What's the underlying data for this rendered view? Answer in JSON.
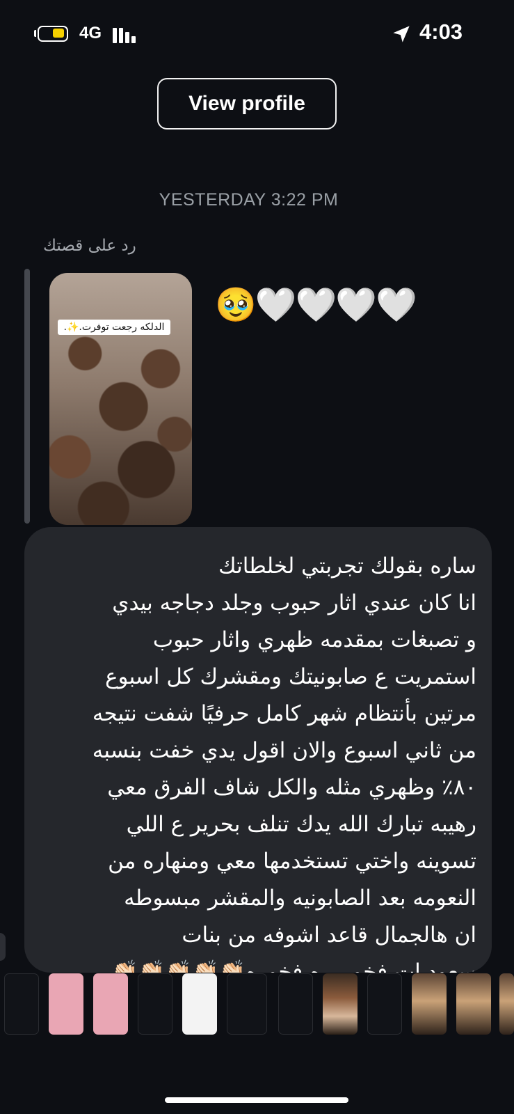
{
  "status_bar": {
    "network": "4G",
    "time": "4:03",
    "battery_color": "#f5d000"
  },
  "header": {
    "view_profile_label": "View profile"
  },
  "conversation": {
    "timestamp": "YESTERDAY 3:22 PM",
    "story_reply_label": "رد على قصتك",
    "story_caption": "الدلكه رجعت توفرت.✨.",
    "emoji_reply": "🥹🤍🤍🤍🤍",
    "message_text": "ساره بقولك تجربتي لخلطاتك\nانا كان عندي اثار حبوب وجلد دجاجه بيدي\nو تصبغات بمقدمه ظهري واثار حبوب\nاستمريت ع صابونيتك ومقشرك كل اسبوع\nمرتين بأنتظام شهر كامل حرفيًا شفت نتيجه\nمن ثاني اسبوع والان اقول يدي خفت بنسبه\n٨٠٪ وظهري مثله والكل شاف الفرق معي\nرهيبه تبارك الله يدك تنلف بحرير ع اللي\nتسوينه واختي تستخدمها معي ومنهاره من\nالنعومه بعد الصابونيه والمقشر مبسوطه\nان هالجمال قاعد اشوفه من بنات\nسعوديات فخوررره فخوره👏🏻👏🏻👏🏻👏🏻👏🏻\n👏🏻❤️❤️❤️❤️❤️"
  },
  "colors": {
    "background": "#0d0f14",
    "bubble": "#25272c",
    "muted_text": "#9aa0a6"
  },
  "icons": [
    "battery-icon",
    "signal-icon",
    "location-arrow-icon"
  ]
}
